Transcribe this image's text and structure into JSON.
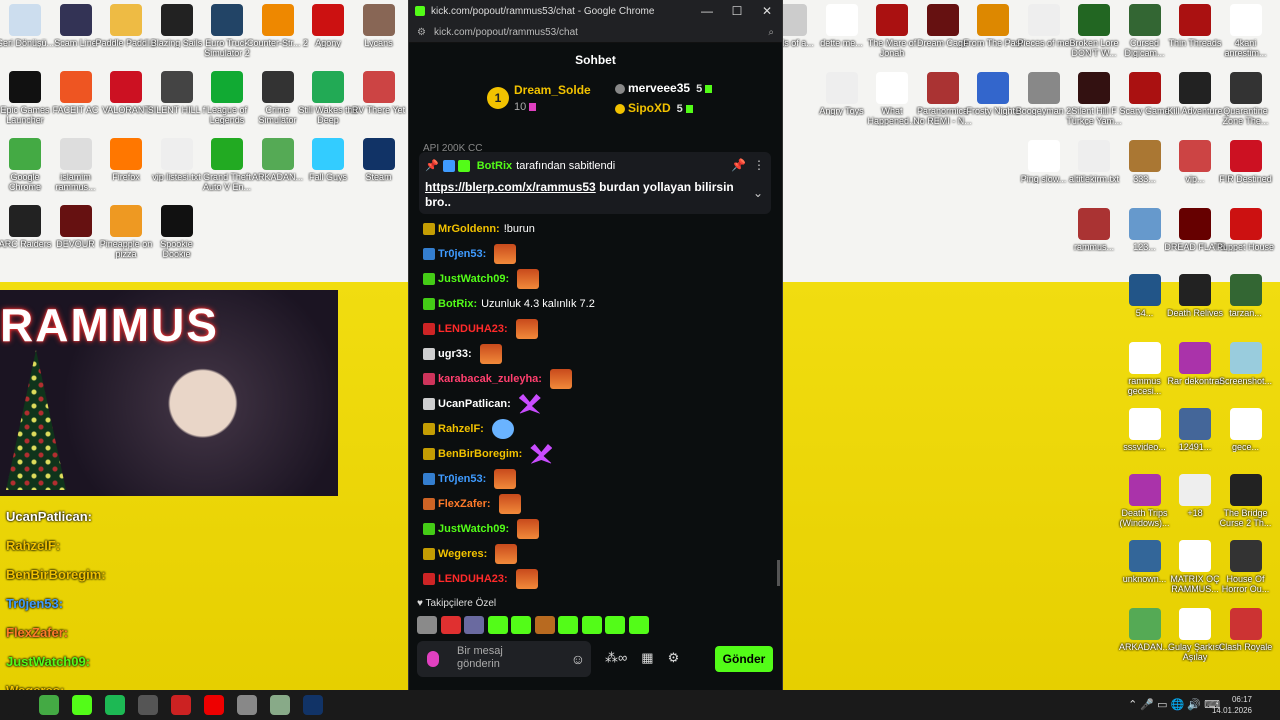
{
  "window": {
    "title": "kick.com/popout/rammus53/chat - Google Chrome",
    "url": "kick.com/popout/rammus53/chat",
    "controls": {
      "minimize": "—",
      "maximize": "☐",
      "close": "✕"
    }
  },
  "chat": {
    "header": "Sohbet",
    "top_gifters": {
      "rank": "1",
      "first": {
        "name": "Dream_Solde",
        "count": "10"
      },
      "second": {
        "name": "merveee35",
        "count": "5"
      },
      "third": {
        "name": "SipoXD",
        "count": "5"
      }
    },
    "partial_text": "API 200K CC",
    "pinned": {
      "by_user": "BotRix",
      "pinned_label": "tarafından sabitlendi",
      "link": "https://blerp.com/x/rammus53",
      "text": "burdan yollayan bilirsin bro.."
    },
    "messages": [
      {
        "user": "MrGoldenn:",
        "text": "!burun",
        "color": "#f2c200",
        "emote": ""
      },
      {
        "user": "Tr0jen53:",
        "text": "",
        "color": "#3f9bff",
        "emote": "orange"
      },
      {
        "user": "JustWatch09:",
        "text": "",
        "color": "#53fc18",
        "emote": "orange"
      },
      {
        "user": "BotRix:",
        "text": "Uzunluk 4.3 kalınlık 7.2",
        "color": "#53fc18",
        "emote": ""
      },
      {
        "user": "LENDUHA23:",
        "text": "",
        "color": "#ff2a2a",
        "emote": "orange"
      },
      {
        "user": "ugr33:",
        "text": "",
        "color": "#ffffff",
        "emote": "orange"
      },
      {
        "user": "karabacak_zuleyha:",
        "text": "",
        "color": "#ff3f6e",
        "emote": "orange"
      },
      {
        "user": "UcanPatlican:",
        "text": "",
        "color": "#ffffff",
        "emote": "purple"
      },
      {
        "user": "RahzelF:",
        "text": "",
        "color": "#f2c200",
        "emote": "char"
      },
      {
        "user": "BenBirBoregim:",
        "text": "",
        "color": "#f2c200",
        "emote": "purple"
      },
      {
        "user": "Tr0jen53:",
        "text": "",
        "color": "#3f9bff",
        "emote": "orange"
      },
      {
        "user": "FlexZafer:",
        "text": "",
        "color": "#ff7a2a",
        "emote": "orange"
      },
      {
        "user": "JustWatch09:",
        "text": "",
        "color": "#53fc18",
        "emote": "orange"
      },
      {
        "user": "Wegeres:",
        "text": "",
        "color": "#f2c200",
        "emote": "orange"
      },
      {
        "user": "LENDUHA23:",
        "text": "",
        "color": "#ff2a2a",
        "emote": "orange"
      }
    ],
    "followers_label": "Takipçilere Özel",
    "input_placeholder": "Bir mesaj gönderin",
    "send_label": "Gönder"
  },
  "overlay": {
    "banner": "RAMMUS",
    "chat": [
      {
        "user": "UcanPatlican:",
        "color": "#ffffff"
      },
      {
        "user": "RahzelF:",
        "color": "#f2c200"
      },
      {
        "user": "BenBirBoregim:",
        "color": "#f2c200"
      },
      {
        "user": "Tr0jen53:",
        "color": "#3f9bff"
      },
      {
        "user": "FlexZafer:",
        "color": "#ff7a2a"
      },
      {
        "user": "JustWatch09:",
        "color": "#53fc18"
      },
      {
        "user": "Wegeres:",
        "color": "#f2c200"
      }
    ]
  },
  "desktop_left": [
    {
      "label": "Geri Dönüşü...",
      "color": "#cde"
    },
    {
      "label": "Scam Line",
      "color": "#335"
    },
    {
      "label": "Paddle Paddl...",
      "color": "#eb4"
    },
    {
      "label": "Blazing Sails",
      "color": "#222"
    },
    {
      "label": "Euro Truck Simulator 2",
      "color": "#246"
    },
    {
      "label": "Counter-Str... 2",
      "color": "#e80"
    },
    {
      "label": "Agony",
      "color": "#c11"
    },
    {
      "label": "Lycans",
      "color": "#865"
    },
    {
      "label": "Epic Games Launcher",
      "color": "#111"
    },
    {
      "label": "FACEIT AC",
      "color": "#e52"
    },
    {
      "label": "VALORANT",
      "color": "#c12"
    },
    {
      "label": "SILENT HILL f",
      "color": "#444"
    },
    {
      "label": "League of Legends",
      "color": "#1a3"
    },
    {
      "label": "Crime Simulator",
      "color": "#333"
    },
    {
      "label": "Still Wakes the Deep",
      "color": "#2a5"
    },
    {
      "label": "RV There Yet",
      "color": "#c44"
    },
    {
      "label": "Google Chrome",
      "color": "#4a4"
    },
    {
      "label": "islamim rammus...",
      "color": "#ddd"
    },
    {
      "label": "Firefox",
      "color": "#f70"
    },
    {
      "label": "vip listesi.txt",
      "color": "#eee"
    },
    {
      "label": "Grand Theft Auto V En...",
      "color": "#2a2"
    },
    {
      "label": "ARKADAN...",
      "color": "#5a5"
    },
    {
      "label": "Fall Guys",
      "color": "#3cf"
    },
    {
      "label": "Steam",
      "color": "#136"
    },
    {
      "label": "ARC Raiders",
      "color": "#222"
    },
    {
      "label": "DEVOUR",
      "color": "#611"
    },
    {
      "label": "Pineapple on pizza",
      "color": "#e92"
    },
    {
      "label": "Spookie Dookie",
      "color": "#111"
    }
  ],
  "desktop_right": [
    {
      "label": "Birds of a...",
      "color": "#ccc"
    },
    {
      "label": "dette me...",
      "color": "#fff"
    },
    {
      "label": "The Mare of Jonah",
      "color": "#a11"
    },
    {
      "label": "Dream Cage",
      "color": "#611"
    },
    {
      "label": "From The Past",
      "color": "#d80"
    },
    {
      "label": "Pieces of me",
      "color": "#eee"
    },
    {
      "label": "Broken Lore DON'T W...",
      "color": "#262"
    },
    {
      "label": "Cursed Digicam...",
      "color": "#363"
    },
    {
      "label": "Thin Threads",
      "color": "#a11"
    },
    {
      "label": "4kani anrestim...",
      "color": "#fff"
    },
    {
      "label": "Angry Toys",
      "color": "#eee"
    },
    {
      "label": "What Happened...",
      "color": "#fff"
    },
    {
      "label": "Paranormica No REMI - N...",
      "color": "#a33"
    },
    {
      "label": "Frosty Nights",
      "color": "#36c"
    },
    {
      "label": "Boogeyman 2",
      "color": "#888"
    },
    {
      "label": "Silent Hill F Türkçe Yam...",
      "color": "#311"
    },
    {
      "label": "Scary Game",
      "color": "#a11"
    },
    {
      "label": "Kill Adventure",
      "color": "#222"
    },
    {
      "label": "Quarantine Zone The...",
      "color": "#333"
    },
    {
      "label": "Ping slow...",
      "color": "#fff"
    },
    {
      "label": "altitlekirm.txt",
      "color": "#eee"
    },
    {
      "label": "333...",
      "color": "#a73"
    },
    {
      "label": "vip...",
      "color": "#c44"
    },
    {
      "label": "FIR Destined",
      "color": "#c12"
    },
    {
      "label": "rammus...",
      "color": "#a33"
    },
    {
      "label": "123...",
      "color": "#69c"
    },
    {
      "label": "DREAD FLATS",
      "color": "#600"
    },
    {
      "label": "Puppet House",
      "color": "#c11"
    },
    {
      "label": "54...",
      "color": "#258"
    },
    {
      "label": "Death Relives",
      "color": "#222"
    },
    {
      "label": "tarzan...",
      "color": "#363"
    },
    {
      "label": "rammus gecesi...",
      "color": "#fff"
    },
    {
      "label": "Rar dekontrar",
      "color": "#a3a"
    },
    {
      "label": "Screenshot...",
      "color": "#9cd"
    },
    {
      "label": "sssvideo...",
      "color": "#fff"
    },
    {
      "label": "12491...",
      "color": "#469"
    },
    {
      "label": "gece...",
      "color": "#fff"
    },
    {
      "label": "Death Trips (Windows)...",
      "color": "#a3a"
    },
    {
      "label": "+18",
      "color": "#eee"
    },
    {
      "label": "The Bridge Curse 2 Th...",
      "color": "#222"
    },
    {
      "label": "unknown...",
      "color": "#369"
    },
    {
      "label": "MATRIX OÇ RAMMUS...",
      "color": "#fff"
    },
    {
      "label": "House Of Horror Ou...",
      "color": "#333"
    },
    {
      "label": "ARKADAN...",
      "color": "#5a5"
    },
    {
      "label": "Gulay Şarkısı Aşılay",
      "color": "#fff"
    },
    {
      "label": "Clash Royale",
      "color": "#c33"
    }
  ],
  "taskbar": {
    "icons": [
      {
        "name": "start-icon",
        "color": "#1a1a1a"
      },
      {
        "name": "chrome-icon",
        "color": "#4a4"
      },
      {
        "name": "kick-icon",
        "color": "#53fc18"
      },
      {
        "name": "spotify-icon",
        "color": "#1db954"
      },
      {
        "name": "obs-icon",
        "color": "#555"
      },
      {
        "name": "game-icon",
        "color": "#c22"
      },
      {
        "name": "youtube-icon",
        "color": "#e00"
      },
      {
        "name": "app-icon",
        "color": "#888"
      },
      {
        "name": "tool-icon",
        "color": "#8a8"
      },
      {
        "name": "steam-icon",
        "color": "#136"
      }
    ],
    "time": "06:17",
    "date": "14.01.2026"
  }
}
